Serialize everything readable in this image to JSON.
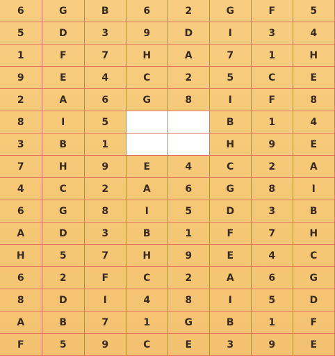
{
  "grid": {
    "rows": [
      [
        "6",
        "G",
        "B",
        "6",
        "2",
        "G",
        "F",
        "5"
      ],
      [
        "5",
        "D",
        "3",
        "9",
        "D",
        "I",
        "3",
        "4"
      ],
      [
        "1",
        "F",
        "7",
        "H",
        "A",
        "7",
        "1",
        "H"
      ],
      [
        "9",
        "E",
        "4",
        "C",
        "2",
        "5",
        "C",
        "E"
      ],
      [
        "2",
        "A",
        "6",
        "G",
        "8",
        "I",
        "F",
        "8"
      ],
      [
        "8",
        "I",
        "5",
        "",
        "",
        "B",
        "1",
        "4"
      ],
      [
        "3",
        "B",
        "1",
        "",
        "",
        "H",
        "9",
        "E"
      ],
      [
        "7",
        "H",
        "9",
        "E",
        "4",
        "C",
        "2",
        "A"
      ],
      [
        "4",
        "C",
        "2",
        "A",
        "6",
        "G",
        "8",
        "I"
      ],
      [
        "6",
        "G",
        "8",
        "I",
        "5",
        "D",
        "3",
        "B"
      ],
      [
        "A",
        "D",
        "3",
        "B",
        "1",
        "F",
        "7",
        "H"
      ],
      [
        "H",
        "5",
        "7",
        "H",
        "9",
        "E",
        "4",
        "C"
      ],
      [
        "6",
        "2",
        "F",
        "C",
        "2",
        "A",
        "6",
        "G"
      ],
      [
        "8",
        "D",
        "I",
        "4",
        "8",
        "I",
        "5",
        "D"
      ],
      [
        "A",
        "B",
        "7",
        "1",
        "G",
        "B",
        "1",
        "F"
      ],
      [
        "F",
        "5",
        "9",
        "C",
        "E",
        "3",
        "9",
        "E"
      ]
    ],
    "blank_cells": [
      [
        5,
        3
      ],
      [
        5,
        4
      ],
      [
        6,
        3
      ],
      [
        6,
        4
      ]
    ]
  },
  "colors": {
    "background": "#f7ca79",
    "grid_line": "#e26f60",
    "text": "#3a2a1e",
    "blank": "#ffffff"
  }
}
